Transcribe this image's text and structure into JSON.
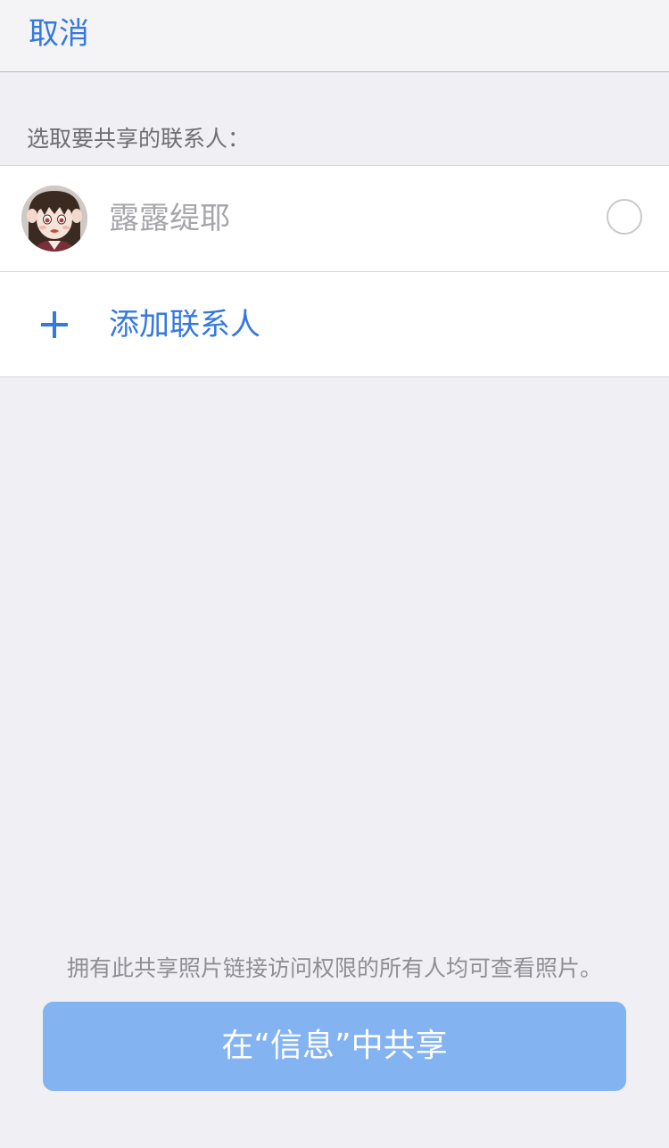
{
  "nav": {
    "cancel_label": "取消"
  },
  "section": {
    "header": "选取要共享的联系人："
  },
  "contacts": [
    {
      "name": "露露缇耶",
      "selected": false,
      "avatar_icon": "avatar-anime-girl-icon"
    }
  ],
  "add_contact": {
    "label": "添加联系人",
    "icon": "plus-icon"
  },
  "footer": {
    "note": "拥有此共享照片链接访问权限的所有人均可查看照片。",
    "share_button_label": "在“信息”中共享"
  },
  "colors": {
    "accent": "#3478e0",
    "button_disabled": "#84b3f2",
    "background": "#efeff4"
  }
}
